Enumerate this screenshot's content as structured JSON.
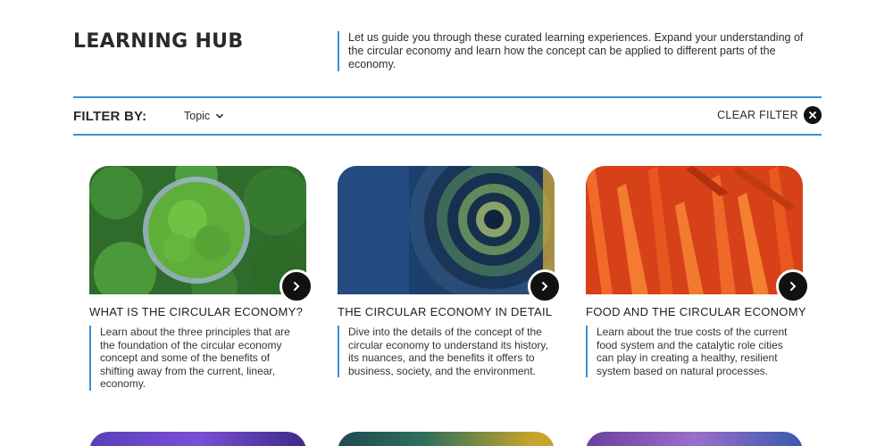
{
  "header": {
    "title": "LEARNING HUB",
    "intro": "Let us guide you through these curated learning experiences. Expand your understanding of the circular economy and learn how the concept can be applied to different parts of the economy."
  },
  "filter": {
    "label": "FILTER BY:",
    "topic": "Topic",
    "clear_label": "CLEAR FILTER"
  },
  "cards": [
    {
      "title": "WHAT IS THE CIRCULAR ECONOMY?",
      "description": "Learn about the three principles that are the foundation of the circular economy concept and some of the benefits of shifting away from the current, linear, economy."
    },
    {
      "title": "THE CIRCULAR ECONOMY IN DETAIL",
      "description": "Dive into the details of the concept of the circular economy to understand its history, its nuances, and the benefits it offers to business, society, and the environment."
    },
    {
      "title": "FOOD AND THE CIRCULAR ECONOMY",
      "description": "Learn about the true costs of the current food system and the catalytic role cities can play in creating a healthy, resilient system based on natural processes."
    }
  ],
  "icons": {
    "chevron": "chevron-down-icon",
    "clear": "close-icon",
    "card_arrow": "chevron-right-icon"
  },
  "colors": {
    "accent": "#3a8fd6",
    "dark": "#111111"
  }
}
